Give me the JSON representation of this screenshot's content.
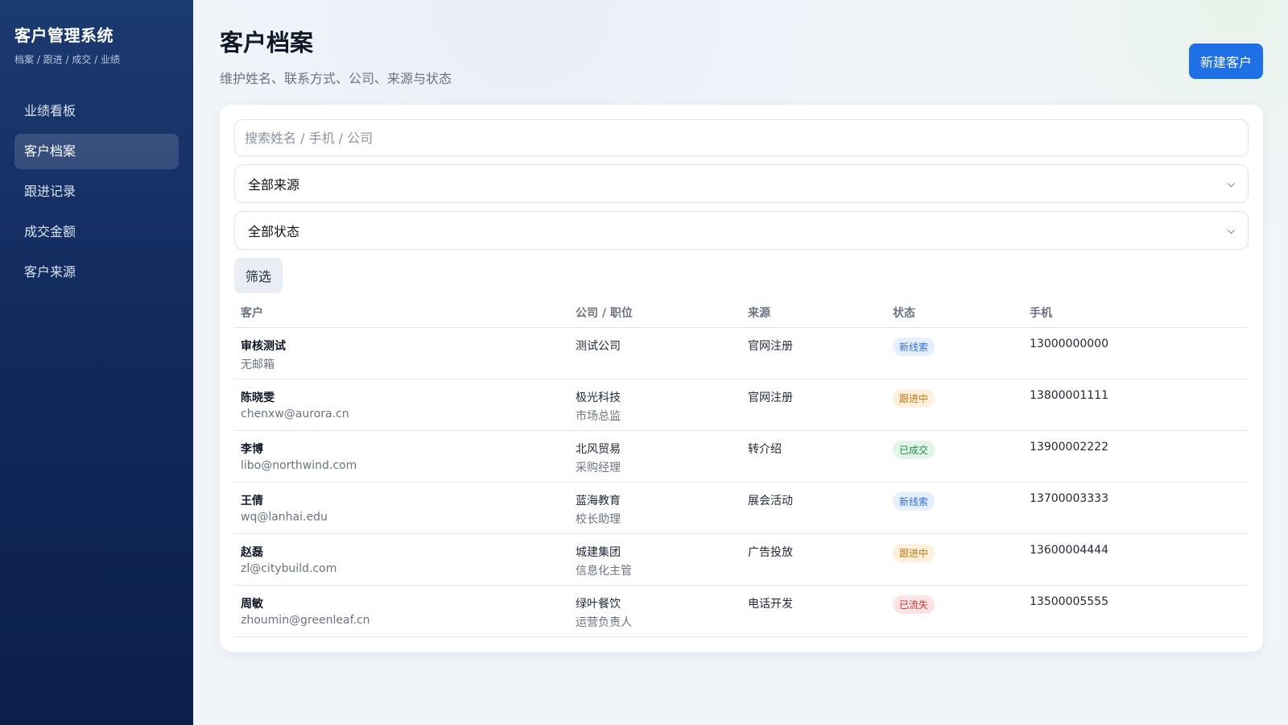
{
  "sidebar": {
    "title": "客户管理系统",
    "subtitle": "档案 / 跟进 / 成交 / 业绩",
    "items": [
      {
        "label": "业绩看板",
        "active": false
      },
      {
        "label": "客户档案",
        "active": true
      },
      {
        "label": "跟进记录",
        "active": false
      },
      {
        "label": "成交金额",
        "active": false
      },
      {
        "label": "客户来源",
        "active": false
      }
    ]
  },
  "header": {
    "title": "客户档案",
    "subtitle": "维护姓名、联系方式、公司、来源与状态",
    "new_button": "新建客户"
  },
  "filters": {
    "search_placeholder": "搜索姓名 / 手机 / 公司",
    "source_selected": "全部来源",
    "status_selected": "全部状态",
    "filter_button": "筛选"
  },
  "table": {
    "columns": [
      "客户",
      "公司 / 职位",
      "来源",
      "状态",
      "手机"
    ],
    "rows": [
      {
        "name": "审核测试",
        "email": "无邮箱",
        "company": "测试公司",
        "position": "",
        "source": "官网注册",
        "status": "新线索",
        "status_kind": "new",
        "phone": "13000000000"
      },
      {
        "name": "陈晓雯",
        "email": "chenxw@aurora.cn",
        "company": "极光科技",
        "position": "市场总监",
        "source": "官网注册",
        "status": "跟进中",
        "status_kind": "follow",
        "phone": "13800001111"
      },
      {
        "name": "李博",
        "email": "libo@northwind.com",
        "company": "北风贸易",
        "position": "采购经理",
        "source": "转介绍",
        "status": "已成交",
        "status_kind": "done",
        "phone": "13900002222"
      },
      {
        "name": "王倩",
        "email": "wq@lanhai.edu",
        "company": "蓝海教育",
        "position": "校长助理",
        "source": "展会活动",
        "status": "新线索",
        "status_kind": "new",
        "phone": "13700003333"
      },
      {
        "name": "赵磊",
        "email": "zl@citybuild.com",
        "company": "城建集团",
        "position": "信息化主管",
        "source": "广告投放",
        "status": "跟进中",
        "status_kind": "follow",
        "phone": "13600004444"
      },
      {
        "name": "周敏",
        "email": "zhoumin@greenleaf.cn",
        "company": "绿叶餐饮",
        "position": "运营负责人",
        "source": "电话开发",
        "status": "已流失",
        "status_kind": "lost",
        "phone": "13500005555"
      }
    ]
  },
  "colors": {
    "sidebar_top": "#1b3a70",
    "sidebar_bottom": "#0b1f49",
    "primary": "#1f6fe5",
    "status_new": "#2f6fd6",
    "status_follow": "#c77814",
    "status_done": "#1f8a4c",
    "status_lost": "#c8353a"
  }
}
